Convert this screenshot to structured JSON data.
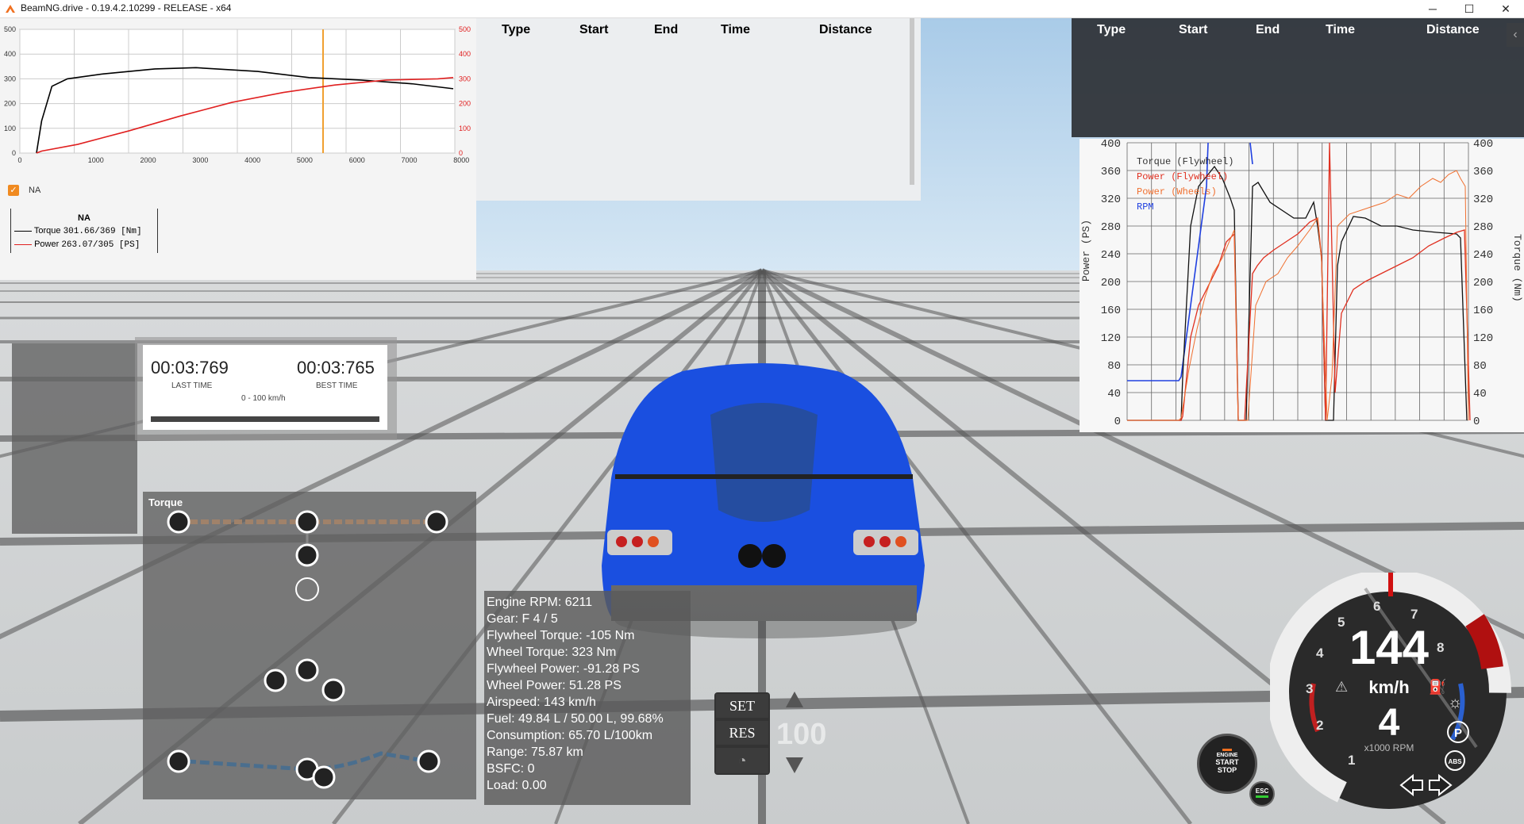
{
  "window": {
    "title": "BeamNG.drive - 0.19.4.2.10299 - RELEASE - x64",
    "minimize": "─",
    "maximize": "☐",
    "close": "✕"
  },
  "dyno": {
    "left_ticks": [
      "500",
      "400",
      "300",
      "200",
      "100",
      "0"
    ],
    "right_ticks": [
      "500",
      "400",
      "300",
      "200",
      "100",
      "0"
    ],
    "x_ticks": [
      "1000",
      "2000",
      "3000",
      "4000",
      "5000",
      "6000",
      "7000",
      "8000"
    ],
    "x_zero": "0",
    "checkbox_label": "NA",
    "legend_title": "NA",
    "torque_label": "Torque",
    "torque_value": "301.66/369 [Nm]",
    "power_label": "Power",
    "power_value": "263.07/305 [PS]",
    "colors": {
      "torque": "#000000",
      "power": "#e02020",
      "marker": "#f0a030"
    }
  },
  "table_light": {
    "headers": [
      "Type",
      "Start",
      "End",
      "Time",
      "Distance"
    ]
  },
  "table_dark": {
    "headers": [
      "Type",
      "Start",
      "End",
      "Time",
      "Distance"
    ],
    "collapse": "‹"
  },
  "graph": {
    "ylabel_left": "Power (PS)",
    "ylabel_right": "Torque (Nm)",
    "ticks": [
      "400",
      "360",
      "320",
      "280",
      "240",
      "200",
      "160",
      "120",
      "80",
      "40",
      "0"
    ],
    "legend": [
      {
        "name": "Torque (Flywheel)",
        "color": "#333333"
      },
      {
        "name": "Power (Flywheel)",
        "color": "#e03020"
      },
      {
        "name": "Power (Wheels)",
        "color": "#f07030"
      },
      {
        "name": "RPM",
        "color": "#2040e0"
      }
    ]
  },
  "timer": {
    "last_time": "00:03:769",
    "last_label": "LAST TIME",
    "best_time": "00:03:765",
    "best_label": "BEST TIME",
    "range": "0 - 100 km/h"
  },
  "drivetrain": {
    "title": "Torque"
  },
  "info": {
    "lines": [
      "Engine RPM: 6211",
      "Gear: F 4 / 5",
      "Flywheel Torque: -105 Nm",
      "Wheel Torque: 323 Nm",
      "Flywheel Power: -91.28 PS",
      "Wheel Power: 51.28 PS",
      "Airspeed: 143 km/h",
      "Fuel: 49.84 L / 50.00 L, 99.68%",
      "Consumption: 65.70 L/100km",
      "Range: 75.87 km",
      "BSFC: 0",
      "Load: 0.00"
    ]
  },
  "cruise": {
    "set": "SET",
    "res": "RES",
    "speed": "100"
  },
  "gauge": {
    "speed": "144",
    "unit": "km/h",
    "gear": "4",
    "rpm_label": "x1000 RPM",
    "rpm_numbers": [
      "1",
      "2",
      "3",
      "4",
      "5",
      "6",
      "7",
      "8"
    ],
    "abs": "ABS",
    "parking": "P",
    "esc": "ESC"
  },
  "engine_button": {
    "line1": "ENGINE",
    "line2": "START",
    "line3": "STOP"
  }
}
